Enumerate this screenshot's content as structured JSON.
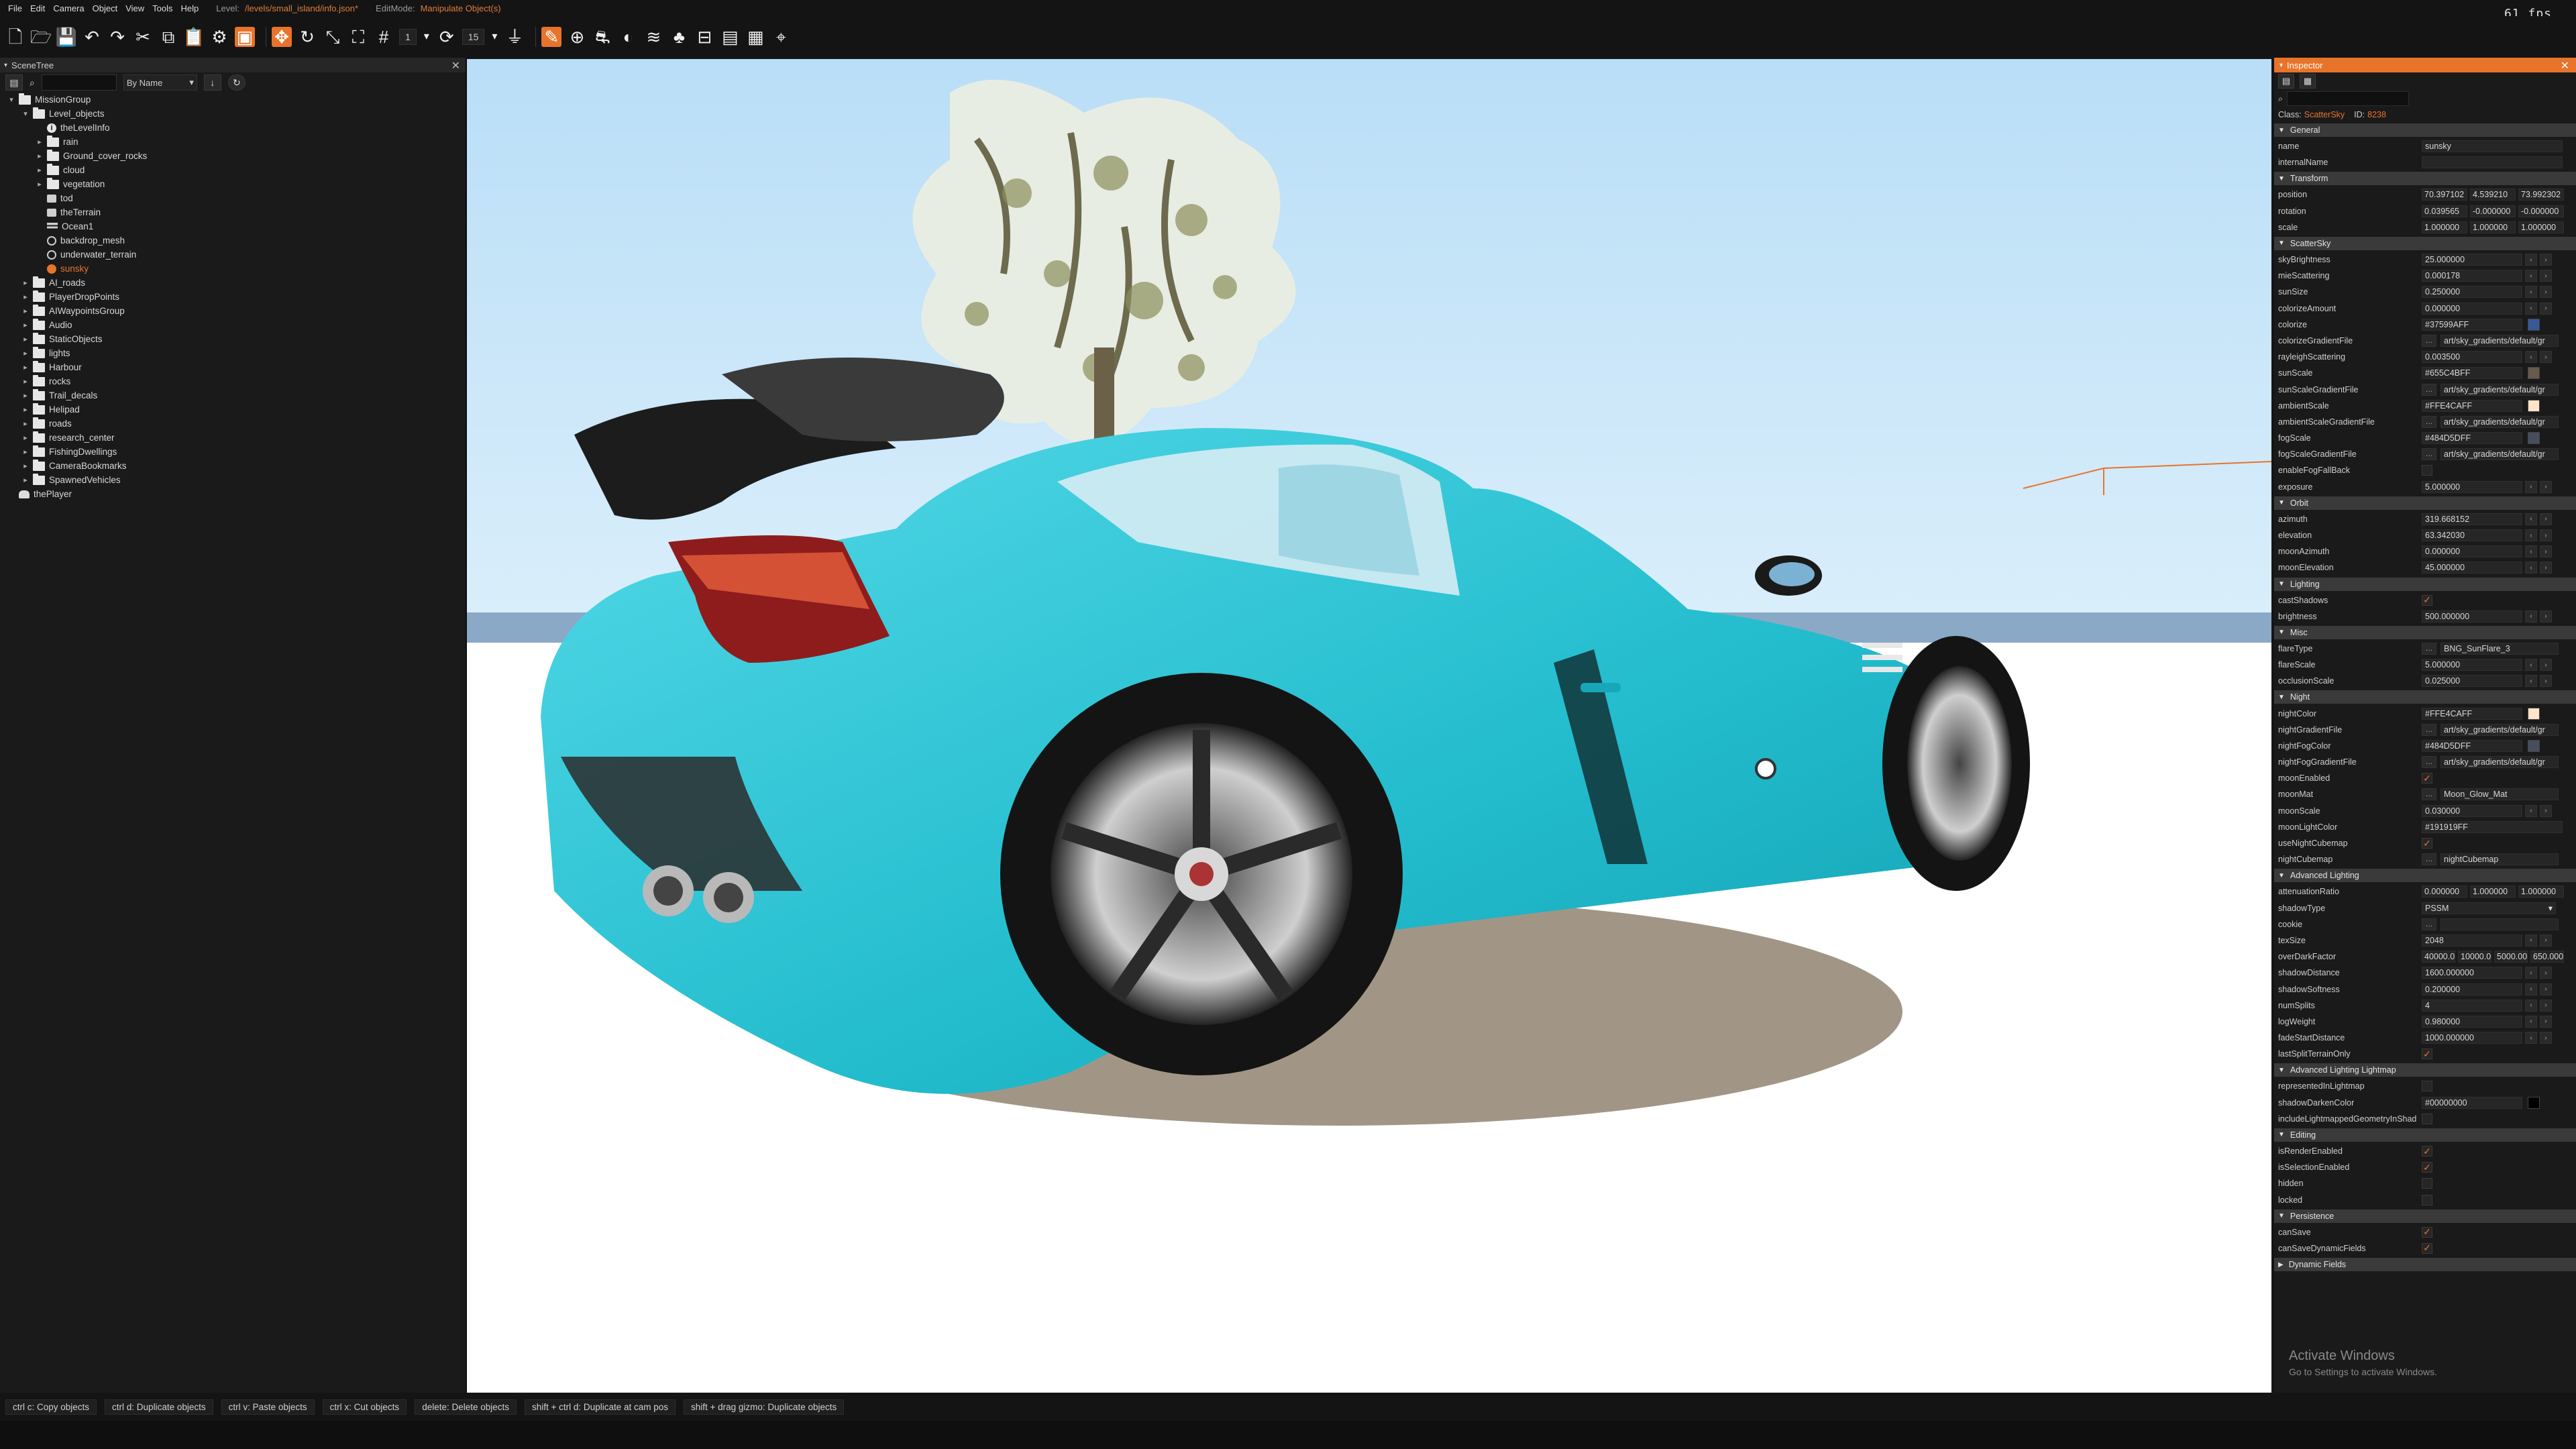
{
  "menubar": {
    "items": [
      "File",
      "Edit",
      "Camera",
      "Object",
      "View",
      "Tools",
      "Help"
    ],
    "level_label": "Level:",
    "level_value": "/levels/small_island/info.json*",
    "editmode_label": "EditMode:",
    "editmode_value": "Manipulate Object(s)"
  },
  "fps": "61 fps",
  "toolbar": {
    "snap_value": "1",
    "angle_value": "15"
  },
  "scenetree": {
    "title": "SceneTree",
    "sort_label": "By Name",
    "items": [
      {
        "label": "MissionGroup",
        "depth": 0,
        "arrow": "▾",
        "icon": "folder"
      },
      {
        "label": "Level_objects",
        "depth": 1,
        "arrow": "▾",
        "icon": "folder"
      },
      {
        "label": "theLevelInfo",
        "depth": 2,
        "arrow": "",
        "icon": "info"
      },
      {
        "label": "rain",
        "depth": 2,
        "arrow": "▸",
        "icon": "folder"
      },
      {
        "label": "Ground_cover_rocks",
        "depth": 2,
        "arrow": "▸",
        "icon": "folder"
      },
      {
        "label": "cloud",
        "depth": 2,
        "arrow": "▸",
        "icon": "folder"
      },
      {
        "label": "vegetation",
        "depth": 2,
        "arrow": "▸",
        "icon": "folder"
      },
      {
        "label": "tod",
        "depth": 2,
        "arrow": "",
        "icon": "obj"
      },
      {
        "label": "theTerrain",
        "depth": 2,
        "arrow": "",
        "icon": "obj"
      },
      {
        "label": "Ocean1",
        "depth": 2,
        "arrow": "",
        "icon": "water"
      },
      {
        "label": "backdrop_mesh",
        "depth": 2,
        "arrow": "",
        "icon": "globe"
      },
      {
        "label": "underwater_terrain",
        "depth": 2,
        "arrow": "",
        "icon": "globe"
      },
      {
        "label": "sunsky",
        "depth": 2,
        "arrow": "",
        "icon": "sky",
        "selected": true
      },
      {
        "label": "AI_roads",
        "depth": 1,
        "arrow": "▸",
        "icon": "folder"
      },
      {
        "label": "PlayerDropPoints",
        "depth": 1,
        "arrow": "▸",
        "icon": "folder"
      },
      {
        "label": "AIWaypointsGroup",
        "depth": 1,
        "arrow": "▸",
        "icon": "folder"
      },
      {
        "label": "Audio",
        "depth": 1,
        "arrow": "▸",
        "icon": "folder"
      },
      {
        "label": "StaticObjects",
        "depth": 1,
        "arrow": "▸",
        "icon": "folder"
      },
      {
        "label": "lights",
        "depth": 1,
        "arrow": "▸",
        "icon": "folder"
      },
      {
        "label": "Harbour",
        "depth": 1,
        "arrow": "▸",
        "icon": "folder"
      },
      {
        "label": "rocks",
        "depth": 1,
        "arrow": "▸",
        "icon": "folder"
      },
      {
        "label": "Trail_decals",
        "depth": 1,
        "arrow": "▸",
        "icon": "folder"
      },
      {
        "label": "Helipad",
        "depth": 1,
        "arrow": "▸",
        "icon": "folder"
      },
      {
        "label": "roads",
        "depth": 1,
        "arrow": "▸",
        "icon": "folder"
      },
      {
        "label": "research_center",
        "depth": 1,
        "arrow": "▸",
        "icon": "folder"
      },
      {
        "label": "FishingDwellings",
        "depth": 1,
        "arrow": "▸",
        "icon": "folder"
      },
      {
        "label": "CameraBookmarks",
        "depth": 1,
        "arrow": "▸",
        "icon": "folder"
      },
      {
        "label": "SpawnedVehicles",
        "depth": 1,
        "arrow": "▸",
        "icon": "folder"
      },
      {
        "label": "thePlayer",
        "depth": 0,
        "arrow": "",
        "icon": "player"
      }
    ]
  },
  "inspector": {
    "title": "Inspector",
    "class_label": "Class:",
    "class_value": "ScatterSky",
    "id_label": "ID:",
    "id_value": "8238",
    "sections": [
      {
        "title": "General",
        "rows": [
          {
            "k": "name",
            "type": "text",
            "v": "sunsky"
          },
          {
            "k": "internalName",
            "type": "text",
            "v": ""
          }
        ]
      },
      {
        "title": "Transform",
        "rows": [
          {
            "k": "position",
            "type": "vec3",
            "v": [
              "70.397102",
              "4.539210",
              "73.992302"
            ]
          },
          {
            "k": "rotation",
            "type": "vec3",
            "v": [
              "0.039565",
              "-0.000000",
              "-0.000000"
            ]
          },
          {
            "k": "scale",
            "type": "vec3",
            "v": [
              "1.000000",
              "1.000000",
              "1.000000"
            ]
          }
        ]
      },
      {
        "title": "ScatterSky",
        "rows": [
          {
            "k": "skyBrightness",
            "type": "num",
            "v": "25.000000"
          },
          {
            "k": "mieScattering",
            "type": "num",
            "v": "0.000178"
          },
          {
            "k": "sunSize",
            "type": "num",
            "v": "0.250000"
          },
          {
            "k": "colorizeAmount",
            "type": "num",
            "v": "0.000000"
          },
          {
            "k": "colorize",
            "type": "color",
            "v": "#37599AFF",
            "c": "#37599a"
          },
          {
            "k": "colorizeGradientFile",
            "type": "file",
            "v": "art/sky_gradients/default/gr"
          },
          {
            "k": "rayleighScattering",
            "type": "num",
            "v": "0.003500"
          },
          {
            "k": "sunScale",
            "type": "color",
            "v": "#655C4BFF",
            "c": "#655c4b"
          },
          {
            "k": "sunScaleGradientFile",
            "type": "file",
            "v": "art/sky_gradients/default/gr"
          },
          {
            "k": "ambientScale",
            "type": "color",
            "v": "#FFE4CAFF",
            "c": "#ffe4ca"
          },
          {
            "k": "ambientScaleGradientFile",
            "type": "file",
            "v": "art/sky_gradients/default/gr"
          },
          {
            "k": "fogScale",
            "type": "color",
            "v": "#484D5DFF",
            "c": "#484d5d"
          },
          {
            "k": "fogScaleGradientFile",
            "type": "file",
            "v": "art/sky_gradients/default/gr"
          },
          {
            "k": "enableFogFallBack",
            "type": "check",
            "v": false
          },
          {
            "k": "exposure",
            "type": "num",
            "v": "5.000000"
          }
        ]
      },
      {
        "title": "Orbit",
        "rows": [
          {
            "k": "azimuth",
            "type": "num",
            "v": "319.668152"
          },
          {
            "k": "elevation",
            "type": "num",
            "v": "63.342030"
          },
          {
            "k": "moonAzimuth",
            "type": "num",
            "v": "0.000000"
          },
          {
            "k": "moonElevation",
            "type": "num",
            "v": "45.000000"
          }
        ]
      },
      {
        "title": "Lighting",
        "rows": [
          {
            "k": "castShadows",
            "type": "check",
            "v": true
          },
          {
            "k": "brightness",
            "type": "num",
            "v": "500.000000"
          }
        ]
      },
      {
        "title": "Misc",
        "rows": [
          {
            "k": "flareType",
            "type": "file",
            "v": "BNG_SunFlare_3"
          },
          {
            "k": "flareScale",
            "type": "num",
            "v": "5.000000"
          },
          {
            "k": "occlusionScale",
            "type": "num",
            "v": "0.025000"
          }
        ]
      },
      {
        "title": "Night",
        "rows": [
          {
            "k": "nightColor",
            "type": "color",
            "v": "#FFE4CAFF",
            "c": "#ffe4ca"
          },
          {
            "k": "nightGradientFile",
            "type": "file",
            "v": "art/sky_gradients/default/gr"
          },
          {
            "k": "nightFogColor",
            "type": "color",
            "v": "#484D5DFF",
            "c": "#484d5d"
          },
          {
            "k": "nightFogGradientFile",
            "type": "file",
            "v": "art/sky_gradients/default/gr"
          },
          {
            "k": "moonEnabled",
            "type": "check",
            "v": true
          },
          {
            "k": "moonMat",
            "type": "file",
            "v": "Moon_Glow_Mat"
          },
          {
            "k": "moonScale",
            "type": "num",
            "v": "0.030000"
          },
          {
            "k": "moonLightColor",
            "type": "text",
            "v": "#191919FF"
          },
          {
            "k": "useNightCubemap",
            "type": "check",
            "v": true
          },
          {
            "k": "nightCubemap",
            "type": "file",
            "v": "nightCubemap"
          }
        ]
      },
      {
        "title": "Advanced Lighting",
        "rows": [
          {
            "k": "attenuationRatio",
            "type": "vec3",
            "v": [
              "0.000000",
              "1.000000",
              "1.000000"
            ]
          },
          {
            "k": "shadowType",
            "type": "dropdown",
            "v": "PSSM"
          },
          {
            "k": "cookie",
            "type": "file",
            "v": ""
          },
          {
            "k": "texSize",
            "type": "num",
            "v": "2048"
          },
          {
            "k": "overDarkFactor",
            "type": "vec4",
            "v": [
              "40000.0",
              "10000.0",
              "5000.00",
              "650.000"
            ]
          },
          {
            "k": "shadowDistance",
            "type": "num",
            "v": "1600.000000"
          },
          {
            "k": "shadowSoftness",
            "type": "num",
            "v": "0.200000"
          },
          {
            "k": "numSplits",
            "type": "num",
            "v": "4"
          },
          {
            "k": "logWeight",
            "type": "num",
            "v": "0.980000"
          },
          {
            "k": "fadeStartDistance",
            "type": "num",
            "v": "1000.000000"
          },
          {
            "k": "lastSplitTerrainOnly",
            "type": "check",
            "v": true
          }
        ]
      },
      {
        "title": "Advanced Lighting Lightmap",
        "rows": [
          {
            "k": "representedInLightmap",
            "type": "check",
            "v": false
          },
          {
            "k": "shadowDarkenColor",
            "type": "color",
            "v": "#00000000",
            "c": "#000000"
          },
          {
            "k": "includeLightmappedGeometryInShad",
            "type": "check",
            "v": false
          }
        ]
      },
      {
        "title": "Editing",
        "rows": [
          {
            "k": "isRenderEnabled",
            "type": "check",
            "v": true
          },
          {
            "k": "isSelectionEnabled",
            "type": "check",
            "v": true
          },
          {
            "k": "hidden",
            "type": "check",
            "v": false
          },
          {
            "k": "locked",
            "type": "check",
            "v": false
          }
        ]
      },
      {
        "title": "Persistence",
        "rows": [
          {
            "k": "canSave",
            "type": "check",
            "v": true
          },
          {
            "k": "canSaveDynamicFields",
            "type": "check",
            "v": true
          }
        ]
      },
      {
        "title": "Dynamic Fields",
        "collapsed": true,
        "rows": []
      }
    ]
  },
  "activate": {
    "title": "Activate Windows",
    "subtitle": "Go to Settings to activate Windows."
  },
  "statusbar": {
    "hints": [
      "ctrl c: Copy objects",
      "ctrl d: Duplicate objects",
      "ctrl v: Paste objects",
      "ctrl x: Cut objects",
      "delete: Delete objects",
      "shift + ctrl d: Duplicate at cam pos",
      "shift + drag gizmo: Duplicate objects"
    ]
  },
  "colors": {
    "accent": "#e8732a",
    "car": "#2ec4d6",
    "sky": "#c8e6f8"
  }
}
